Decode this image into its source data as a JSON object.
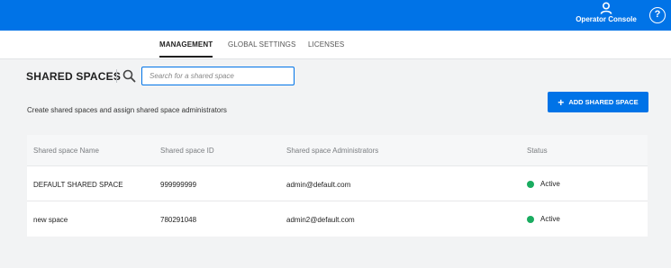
{
  "header": {
    "console_label": "Operator Console",
    "console_icon": "user-icon",
    "help_glyph": "?",
    "help_icon": "help-icon",
    "brand_color": "#0073e7"
  },
  "tabs": [
    {
      "label": "MANAGEMENT",
      "active": true
    },
    {
      "label": "GLOBAL SETTINGS",
      "active": false
    },
    {
      "label": "LICENSES",
      "active": false
    }
  ],
  "main": {
    "title": "SHARED SPACES",
    "search_placeholder": "Search for a shared space",
    "search_value": "",
    "subtitle": "Create shared spaces and assign shared space administrators",
    "add_button_icon": "+",
    "add_button_label": "ADD SHARED SPACE"
  },
  "table": {
    "columns": [
      "Shared space Name",
      "Shared space ID",
      "Shared space Administrators",
      "Status"
    ],
    "rows": [
      {
        "name": "DEFAULT SHARED SPACE",
        "id": "999999999",
        "admins": "admin@default.com",
        "status": "Active"
      },
      {
        "name": "new space",
        "id": "780291048",
        "admins": "admin2@default.com",
        "status": "Active"
      }
    ],
    "status_color": "#1aac60"
  }
}
